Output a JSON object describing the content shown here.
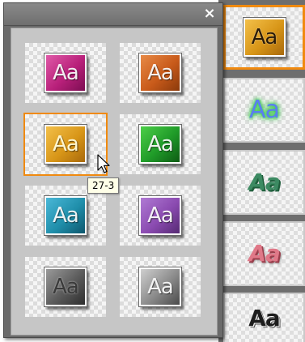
{
  "panel": {
    "close_label": "×",
    "tooltip": "27-3",
    "tiles": [
      {
        "label": "Aa",
        "style": "magenta",
        "color": "#b8207a"
      },
      {
        "label": "Aa",
        "style": "orange",
        "color": "#c85a1a"
      },
      {
        "label": "Aa",
        "style": "gold",
        "color": "#d89618",
        "selected": true
      },
      {
        "label": "Aa",
        "style": "green",
        "color": "#1f9a28"
      },
      {
        "label": "Aa",
        "style": "teal",
        "color": "#1f8eaa"
      },
      {
        "label": "Aa",
        "style": "purple",
        "color": "#8a4ab0"
      },
      {
        "label": "Aa",
        "style": "gray",
        "color": "#5a5a5a"
      },
      {
        "label": "Aa",
        "style": "light-gray",
        "color": "#8a8a8a"
      }
    ]
  },
  "right_strip": {
    "tiles": [
      {
        "label": "Aa",
        "style": "gold",
        "color": "#d89618",
        "selected": true
      },
      {
        "label": "Aa",
        "style": "blue-green-glow"
      },
      {
        "label": "Aa",
        "style": "green-3d"
      },
      {
        "label": "Aa",
        "style": "pink-3d"
      },
      {
        "label": "Aa",
        "style": "black-outline"
      }
    ]
  }
}
